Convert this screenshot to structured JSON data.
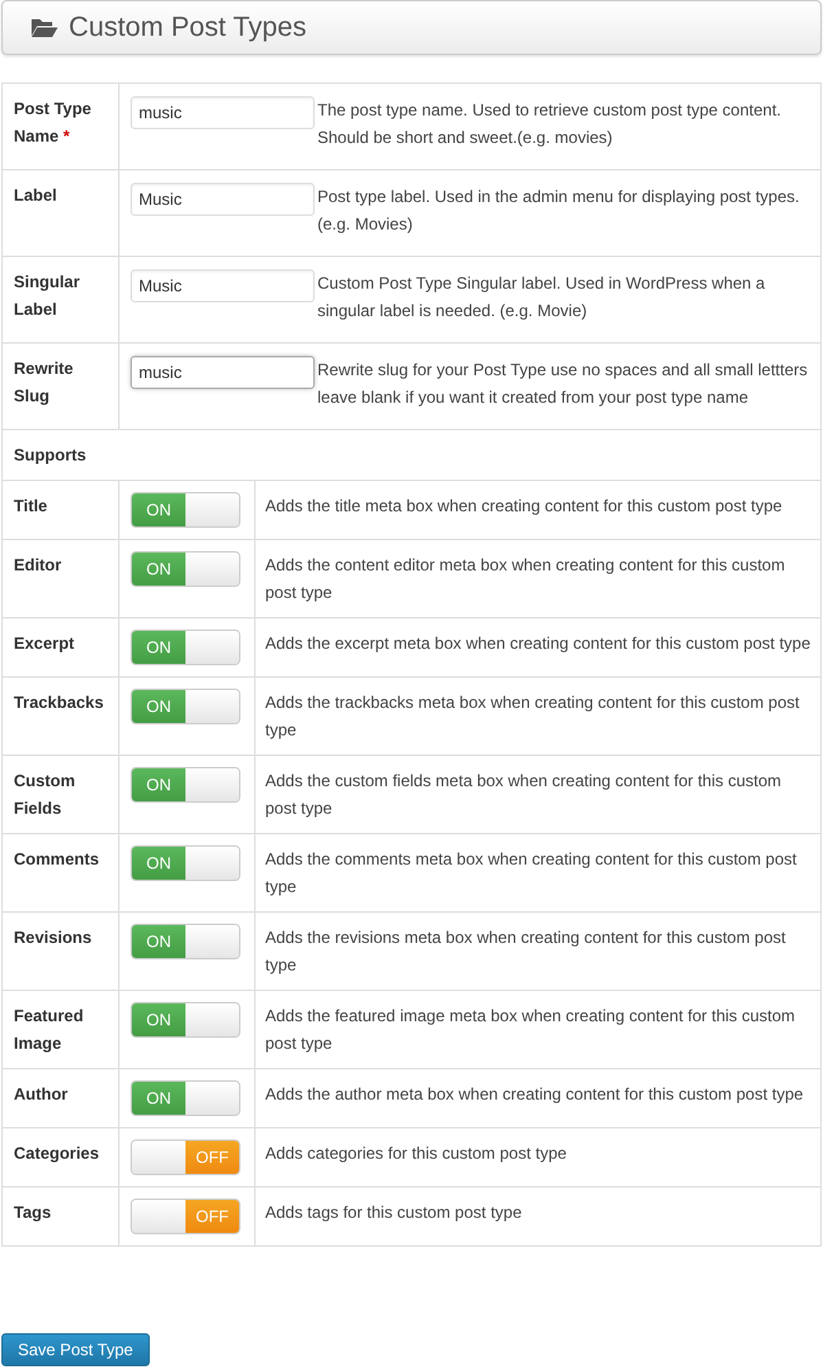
{
  "header": {
    "title": "Custom Post Types"
  },
  "fields": [
    {
      "label": "Post Type Name",
      "required_mark": "*",
      "value": "music",
      "focused": false,
      "help": "The post type name. Used to retrieve custom post type content. Should be short and sweet.(e.g. movies)"
    },
    {
      "label": "Label",
      "value": "Music",
      "focused": false,
      "help": "Post type label. Used in the admin menu for displaying post types.(e.g. Movies)"
    },
    {
      "label": "Singular Label",
      "value": "Music",
      "focused": false,
      "help": "Custom Post Type Singular label. Used in WordPress when a singular label is needed. (e.g. Movie)"
    },
    {
      "label": "Rewrite Slug",
      "value": "music",
      "focused": true,
      "help": "Rewrite slug for your Post Type use no spaces and all small lettters leave blank if you want it created from your post type name"
    }
  ],
  "supports_heading": "Supports",
  "supports": [
    {
      "label": "Title",
      "on": true,
      "switch_text": "ON",
      "help": "Adds the title meta box when creating content for this custom post type"
    },
    {
      "label": "Editor",
      "on": true,
      "switch_text": "ON",
      "help": "Adds the content editor meta box when creating content for this custom post type"
    },
    {
      "label": "Excerpt",
      "on": true,
      "switch_text": "ON",
      "help": "Adds the excerpt meta box when creating content for this custom post type"
    },
    {
      "label": "Trackbacks",
      "on": true,
      "switch_text": "ON",
      "help": "Adds the trackbacks meta box when creating content for this custom post type"
    },
    {
      "label": "Custom Fields",
      "on": true,
      "switch_text": "ON",
      "help": "Adds the custom fields meta box when creating content for this custom post type"
    },
    {
      "label": "Comments",
      "on": true,
      "switch_text": "ON",
      "help": "Adds the comments meta box when creating content for this custom post type"
    },
    {
      "label": "Revisions",
      "on": true,
      "switch_text": "ON",
      "help": "Adds the revisions meta box when creating content for this custom post type"
    },
    {
      "label": "Featured Image",
      "on": true,
      "switch_text": "ON",
      "help": "Adds the featured image meta box when creating content for this custom post type"
    },
    {
      "label": "Author",
      "on": true,
      "switch_text": "ON",
      "help": "Adds the author meta box when creating content for this custom post type"
    },
    {
      "label": "Categories",
      "on": false,
      "switch_text": "OFF",
      "help": "Adds categories for this custom post type"
    },
    {
      "label": "Tags",
      "on": false,
      "switch_text": "OFF",
      "help": "Adds tags for this custom post type"
    }
  ],
  "save_button": "Save Post Type"
}
